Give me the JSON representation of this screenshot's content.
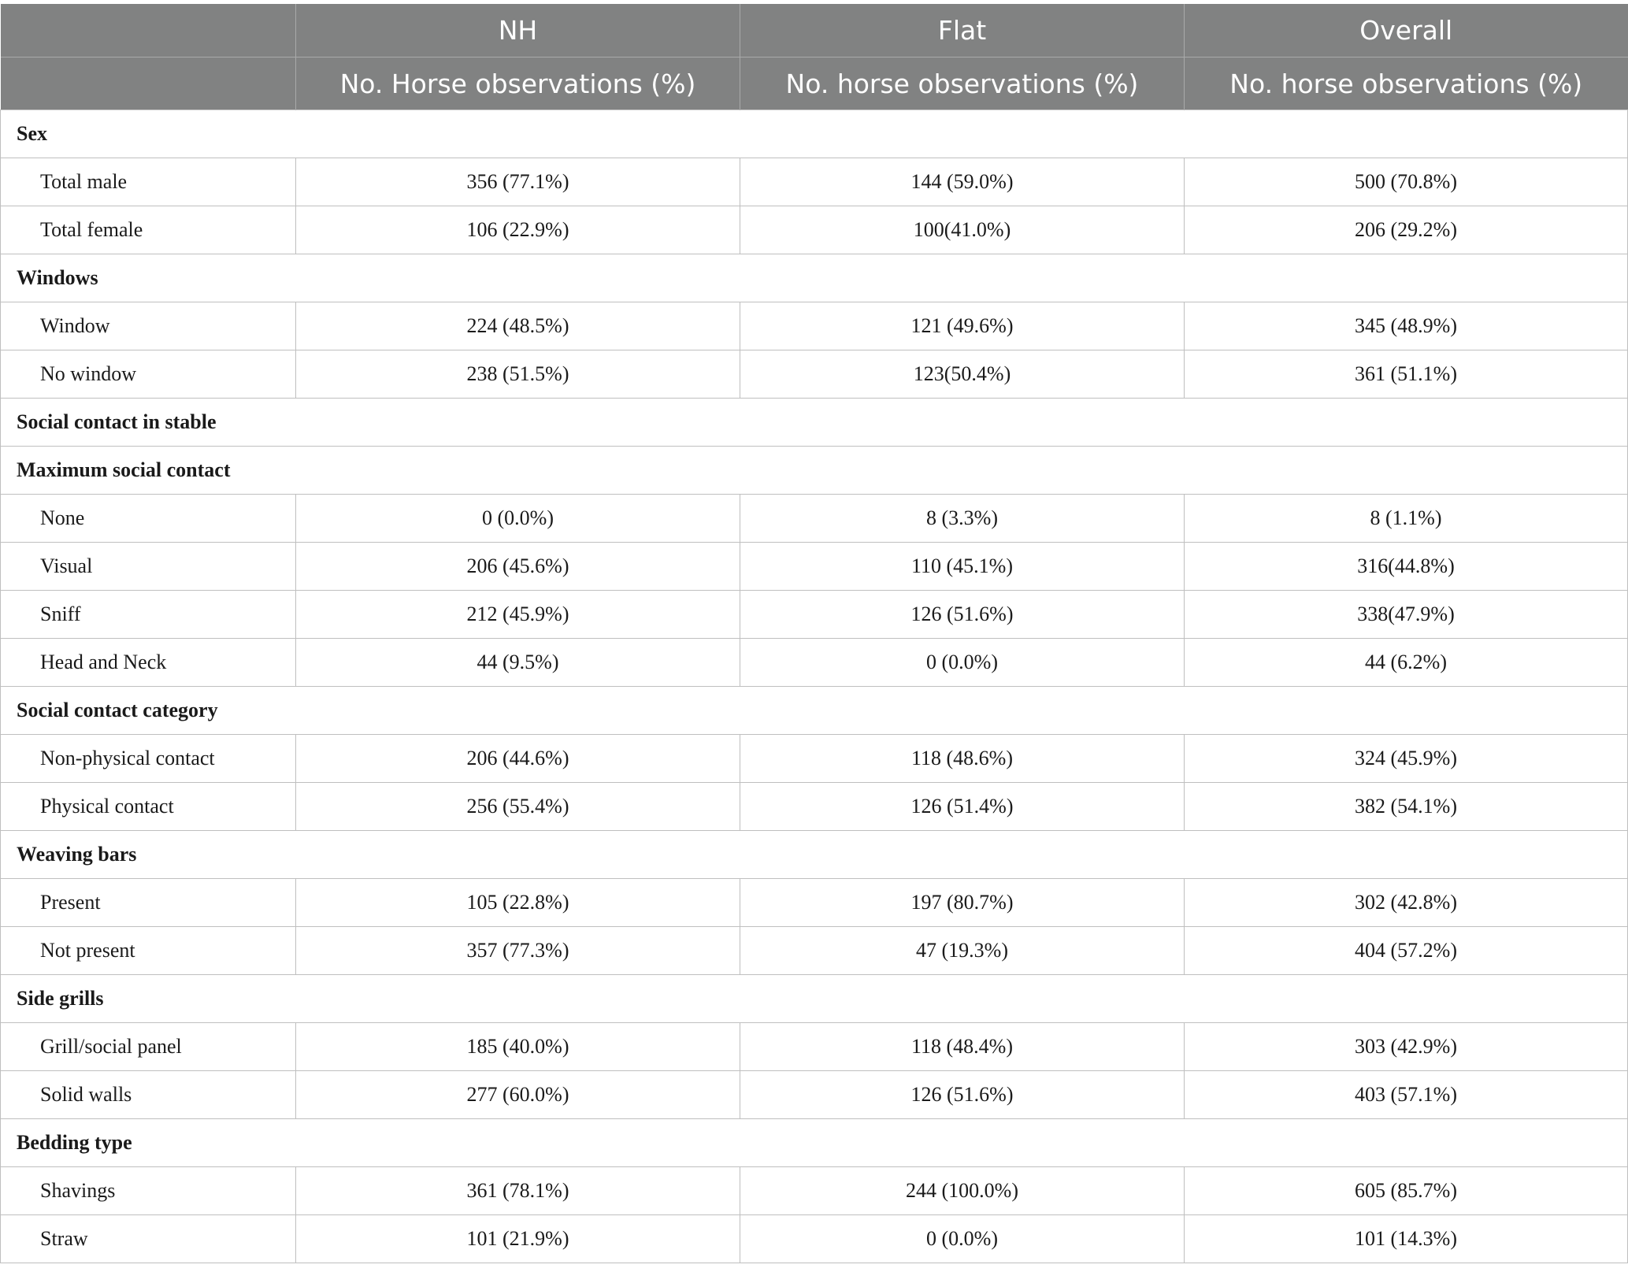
{
  "header": {
    "groups": [
      "NH",
      "Flat",
      "Overall"
    ],
    "subheaders": [
      "No. Horse observations (%)",
      "No. horse observations (%)",
      "No. horse observations (%)"
    ]
  },
  "rows": [
    {
      "type": "section",
      "label": "Sex"
    },
    {
      "type": "data",
      "label": "Total male",
      "values": [
        "356 (77.1%)",
        "144 (59.0%)",
        "500 (70.8%)"
      ]
    },
    {
      "type": "data",
      "label": "Total female",
      "values": [
        "106 (22.9%)",
        "100(41.0%)",
        "206 (29.2%)"
      ]
    },
    {
      "type": "section",
      "label": "Windows"
    },
    {
      "type": "data",
      "label": "Window",
      "values": [
        "224 (48.5%)",
        "121 (49.6%)",
        "345 (48.9%)"
      ]
    },
    {
      "type": "data",
      "label": "No window",
      "values": [
        "238 (51.5%)",
        "123(50.4%)",
        "361 (51.1%)"
      ]
    },
    {
      "type": "section",
      "label": "Social contact in stable"
    },
    {
      "type": "section",
      "label": "Maximum social contact"
    },
    {
      "type": "data",
      "label": "None",
      "values": [
        "0 (0.0%)",
        "8 (3.3%)",
        "8 (1.1%)"
      ]
    },
    {
      "type": "data",
      "label": "Visual",
      "values": [
        "206 (45.6%)",
        "110 (45.1%)",
        "316(44.8%)"
      ]
    },
    {
      "type": "data",
      "label": "Sniff",
      "values": [
        "212 (45.9%)",
        "126 (51.6%)",
        "338(47.9%)"
      ]
    },
    {
      "type": "data",
      "label": "Head and Neck",
      "values": [
        "44 (9.5%)",
        "0 (0.0%)",
        "44 (6.2%)"
      ]
    },
    {
      "type": "section",
      "label": "Social contact category"
    },
    {
      "type": "data",
      "label": "Non-physical contact",
      "values": [
        "206 (44.6%)",
        "118 (48.6%)",
        "324 (45.9%)"
      ]
    },
    {
      "type": "data",
      "label": "Physical contact",
      "values": [
        "256 (55.4%)",
        "126 (51.4%)",
        "382 (54.1%)"
      ]
    },
    {
      "type": "section",
      "label": "Weaving bars"
    },
    {
      "type": "data",
      "label": "Present",
      "values": [
        "105 (22.8%)",
        "197 (80.7%)",
        "302 (42.8%)"
      ]
    },
    {
      "type": "data",
      "label": "Not present",
      "values": [
        "357 (77.3%)",
        "47 (19.3%)",
        "404 (57.2%)"
      ]
    },
    {
      "type": "section",
      "label": "Side grills"
    },
    {
      "type": "data",
      "label": "Grill/social panel",
      "values": [
        "185 (40.0%)",
        "118 (48.4%)",
        "303 (42.9%)"
      ]
    },
    {
      "type": "data",
      "label": "Solid walls",
      "values": [
        "277 (60.0%)",
        "126 (51.6%)",
        "403 (57.1%)"
      ]
    },
    {
      "type": "section",
      "label": "Bedding type"
    },
    {
      "type": "data",
      "label": "Shavings",
      "values": [
        "361 (78.1%)",
        "244 (100.0%)",
        "605 (85.7%)"
      ]
    },
    {
      "type": "data",
      "label": "Straw",
      "values": [
        "101 (21.9%)",
        "0 (0.0%)",
        "101 (14.3%)"
      ]
    }
  ]
}
